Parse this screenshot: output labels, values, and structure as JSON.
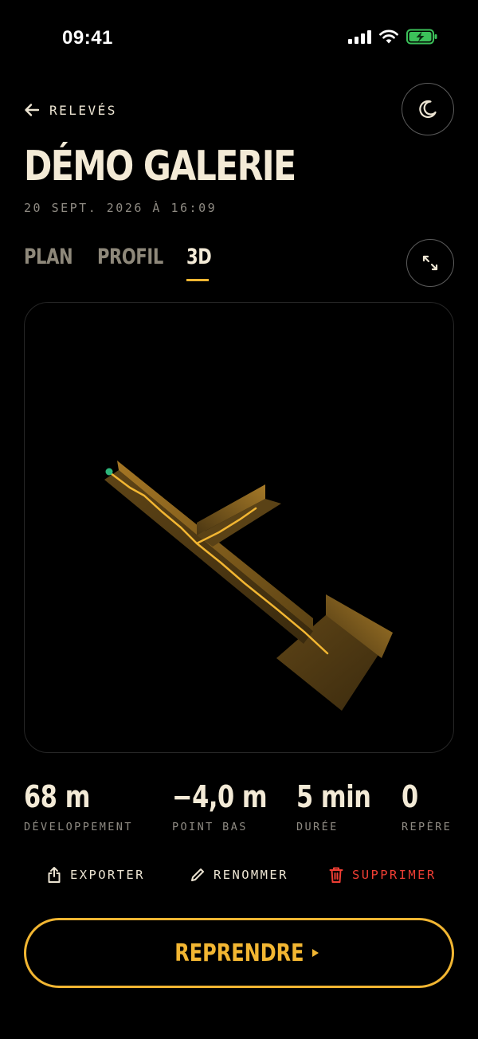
{
  "status_bar": {
    "time": "09:41",
    "icons": [
      "signal-icon",
      "wifi-icon",
      "battery-charging-icon"
    ]
  },
  "header": {
    "back_label": "RELEVÉS",
    "back_icon": "arrow-left-icon",
    "theme_icon": "moon-icon",
    "title": "DÉMO GALERIE",
    "subtitle": "20 SEPT. 2026 À 16:09"
  },
  "tabs": [
    {
      "label": "PLAN",
      "active": false
    },
    {
      "label": "PROFIL",
      "active": false
    },
    {
      "label": "3D",
      "active": true
    }
  ],
  "expand_icon": "expand-icon",
  "viewport": {
    "content": "3d-survey-model",
    "colors": {
      "wall": "#6b4e18",
      "floor": "#4a3412",
      "path": "#f2b632",
      "start_marker": "#2db47a"
    }
  },
  "stats": [
    {
      "value": "68 m",
      "label": "DÉVELOPPEMENT"
    },
    {
      "value": "−4,0 m",
      "label": "POINT BAS"
    },
    {
      "value": "5 min",
      "label": "DURÉE"
    },
    {
      "value": "0",
      "label": "REPÈRE"
    }
  ],
  "actions": {
    "export_label": "EXPORTER",
    "export_icon": "share-icon",
    "rename_label": "RENOMMER",
    "rename_icon": "pencil-icon",
    "delete_label": "SUPPRIMER",
    "delete_icon": "trash-icon"
  },
  "resume": {
    "label": "REPRENDRE",
    "icon": "play-icon"
  },
  "colors": {
    "background": "#000000",
    "text": "#f3ead6",
    "muted": "#8e8a82",
    "accent": "#f2b632",
    "danger": "#ee3e34"
  }
}
